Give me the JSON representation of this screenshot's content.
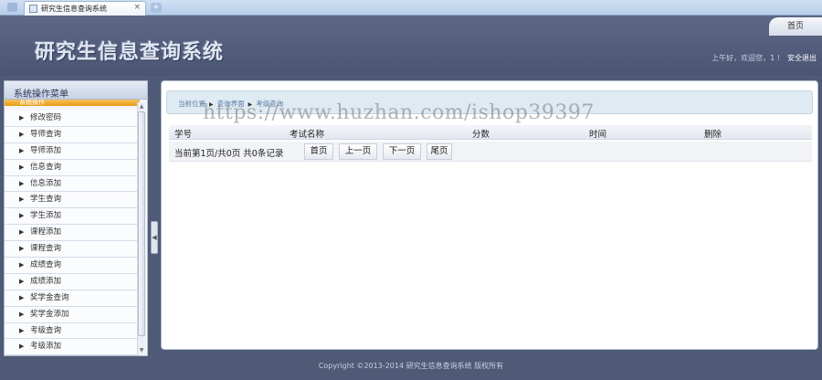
{
  "browser": {
    "tab_title": "研究生信息查询系统",
    "tab_close": "×",
    "new_tab": "+"
  },
  "header": {
    "site_title": "研究生信息查询系统",
    "home_label": "首页",
    "greeting": "上午好，欢迎您，1 !",
    "logout_label": "安全退出"
  },
  "sidebar": {
    "title": "系统操作菜单",
    "section_label": "系统操作",
    "items": [
      {
        "label": "修改密码"
      },
      {
        "label": "导师查询"
      },
      {
        "label": "导师添加"
      },
      {
        "label": "信息查询"
      },
      {
        "label": "信息添加"
      },
      {
        "label": "学生查询"
      },
      {
        "label": "学生添加"
      },
      {
        "label": "课程添加"
      },
      {
        "label": "课程查询"
      },
      {
        "label": "成绩查询"
      },
      {
        "label": "成绩添加"
      },
      {
        "label": "奖学金查询"
      },
      {
        "label": "奖学金添加"
      },
      {
        "label": "考级查询"
      },
      {
        "label": "考级添加"
      }
    ]
  },
  "breadcrumb": {
    "items": [
      "当前位置",
      "查询界面",
      "考级查询"
    ]
  },
  "table": {
    "headers": [
      "学号",
      "考试名称",
      "分数",
      "时间",
      "删除"
    ]
  },
  "pager": {
    "info": "当前第1页/共0页  共0条记录",
    "first_label": "首页",
    "prev_label": "上一页",
    "next_label": "下一页",
    "last_label": "尾页"
  },
  "footer": {
    "copyright": "Copyright ©2013-2014 研究生信息查询系统 版权所有"
  },
  "watermark": {
    "text": "https://www.huzhan.com/ishop39397"
  },
  "colors": {
    "header_bg": "#4f5a76",
    "menu_section": "#e79a16",
    "breadcrumb_bg": "#dfeaf2"
  }
}
